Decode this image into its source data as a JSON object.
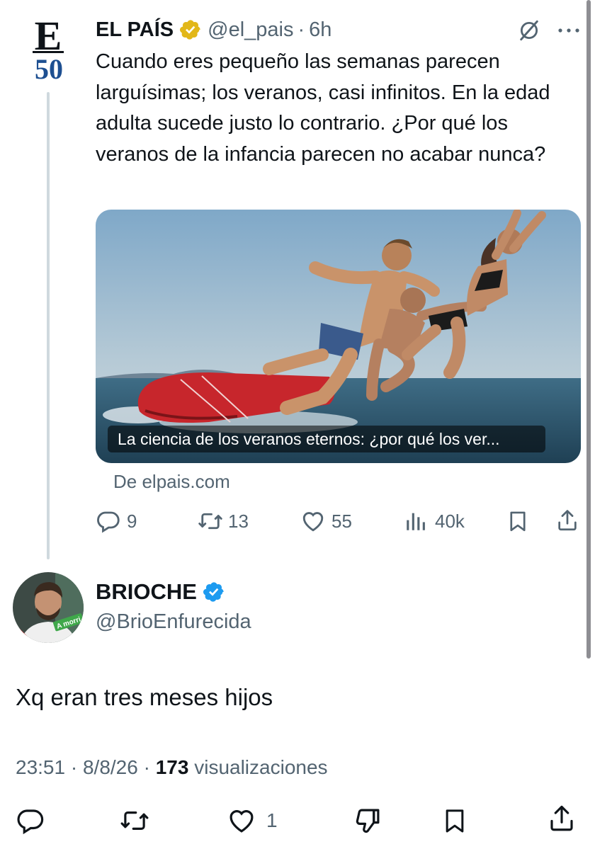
{
  "quoted": {
    "logo": {
      "letter": "E",
      "number": "50"
    },
    "author_name": "EL PAÍS",
    "handle": "@el_pais",
    "separator": "·",
    "time": "6h",
    "text": "Cuando eres pequeño las semanas parecen larguísimas; los veranos, casi infinitos. En la edad adulta sucede justo lo contrario. ¿Por qué los veranos de la infancia parecen no acabar nunca?",
    "card_caption": "La ciencia de los veranos eternos: ¿por qué los ver...",
    "card_source": "De elpais.com",
    "actions": {
      "replies": "9",
      "reposts": "13",
      "likes": "55",
      "views": "40k"
    },
    "badge_color": "#e2b719"
  },
  "reply": {
    "author_name": "BRIOCHE",
    "handle": "@BrioEnfurecida",
    "avatar_tag": "A morri",
    "text": "Xq eran tres meses hijos",
    "time": "23:51",
    "date": "8/8/26",
    "views_count": "173",
    "views_label": "visualizaciones",
    "likes": "1",
    "badge_color": "#1d9bf0"
  }
}
